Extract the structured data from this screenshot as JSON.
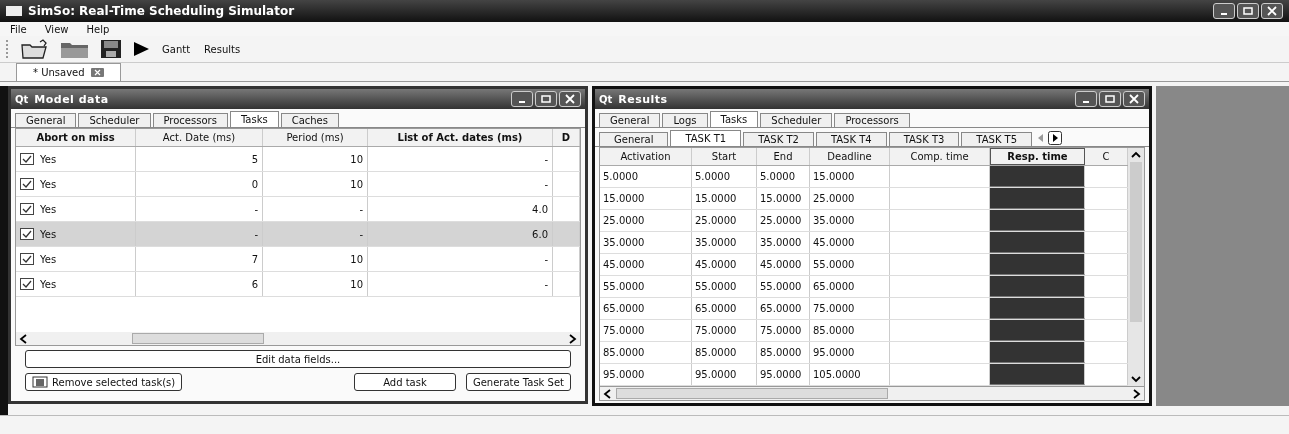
{
  "window": {
    "title": "SimSo: Real-Time Scheduling Simulator"
  },
  "menu": [
    "File",
    "View",
    "Help"
  ],
  "toolbar": [
    {
      "kind": "new"
    },
    {
      "kind": "open"
    },
    {
      "kind": "save"
    },
    {
      "kind": "run"
    },
    {
      "kind": "text",
      "label": "Gantt"
    },
    {
      "kind": "text",
      "label": "Results"
    }
  ],
  "document_tabs": [
    {
      "label": "* Unsaved",
      "selected": true
    }
  ],
  "model_window": {
    "badge": "Qt",
    "title": "Model data",
    "tabs": [
      {
        "label": "General",
        "selected": false
      },
      {
        "label": "Scheduler",
        "selected": false
      },
      {
        "label": "Processors",
        "selected": false
      },
      {
        "label": "Tasks",
        "selected": true
      },
      {
        "label": "Caches",
        "selected": false
      }
    ],
    "columns": [
      "Abort on miss",
      "Act. Date (ms)",
      "Period (ms)",
      "List of Act. dates (ms)",
      "D"
    ],
    "rows": [
      {
        "abort": "Yes",
        "checked": true,
        "act_date": "5",
        "period": "10",
        "act_dates": "-",
        "selected": false
      },
      {
        "abort": "Yes",
        "checked": true,
        "act_date": "0",
        "period": "10",
        "act_dates": "-",
        "selected": false
      },
      {
        "abort": "Yes",
        "checked": true,
        "act_date": "-",
        "period": "-",
        "act_dates": "4.0",
        "selected": false
      },
      {
        "abort": "Yes",
        "checked": true,
        "act_date": "-",
        "period": "-",
        "act_dates": "6.0",
        "selected": true
      },
      {
        "abort": "Yes",
        "checked": true,
        "act_date": "7",
        "period": "10",
        "act_dates": "-",
        "selected": false
      },
      {
        "abort": "Yes",
        "checked": true,
        "act_date": "6",
        "period": "10",
        "act_dates": "-",
        "selected": false
      }
    ],
    "edit_button": "Edit data fields...",
    "remove_button": "Remove selected task(s)",
    "add_button": "Add task",
    "generate_button": "Generate Task Set"
  },
  "results_window": {
    "badge": "Qt",
    "title": "Results",
    "tabs": [
      {
        "label": "General",
        "selected": false
      },
      {
        "label": "Logs",
        "selected": false
      },
      {
        "label": "Tasks",
        "selected": true
      },
      {
        "label": "Scheduler",
        "selected": false
      },
      {
        "label": "Processors",
        "selected": false
      }
    ],
    "task_tabs": [
      {
        "label": "General",
        "selected": false
      },
      {
        "label": "TASK T1",
        "selected": true
      },
      {
        "label": "TASK T2",
        "selected": false
      },
      {
        "label": "TASK T4",
        "selected": false
      },
      {
        "label": "TASK T3",
        "selected": false
      },
      {
        "label": "TASK T5",
        "selected": false
      }
    ],
    "columns": [
      "Activation",
      "Start",
      "End",
      "Deadline",
      "Comp. time",
      "Resp. time",
      "C"
    ],
    "rows": [
      [
        "5.0000",
        "5.0000",
        "5.0000",
        "15.0000"
      ],
      [
        "15.0000",
        "15.0000",
        "15.0000",
        "25.0000"
      ],
      [
        "25.0000",
        "25.0000",
        "25.0000",
        "35.0000"
      ],
      [
        "35.0000",
        "35.0000",
        "35.0000",
        "45.0000"
      ],
      [
        "45.0000",
        "45.0000",
        "45.0000",
        "55.0000"
      ],
      [
        "55.0000",
        "55.0000",
        "55.0000",
        "65.0000"
      ],
      [
        "65.0000",
        "65.0000",
        "65.0000",
        "75.0000"
      ],
      [
        "75.0000",
        "75.0000",
        "75.0000",
        "85.0000"
      ],
      [
        "85.0000",
        "85.0000",
        "85.0000",
        "95.0000"
      ],
      [
        "95.0000",
        "95.0000",
        "95.0000",
        "105.0000"
      ]
    ]
  }
}
